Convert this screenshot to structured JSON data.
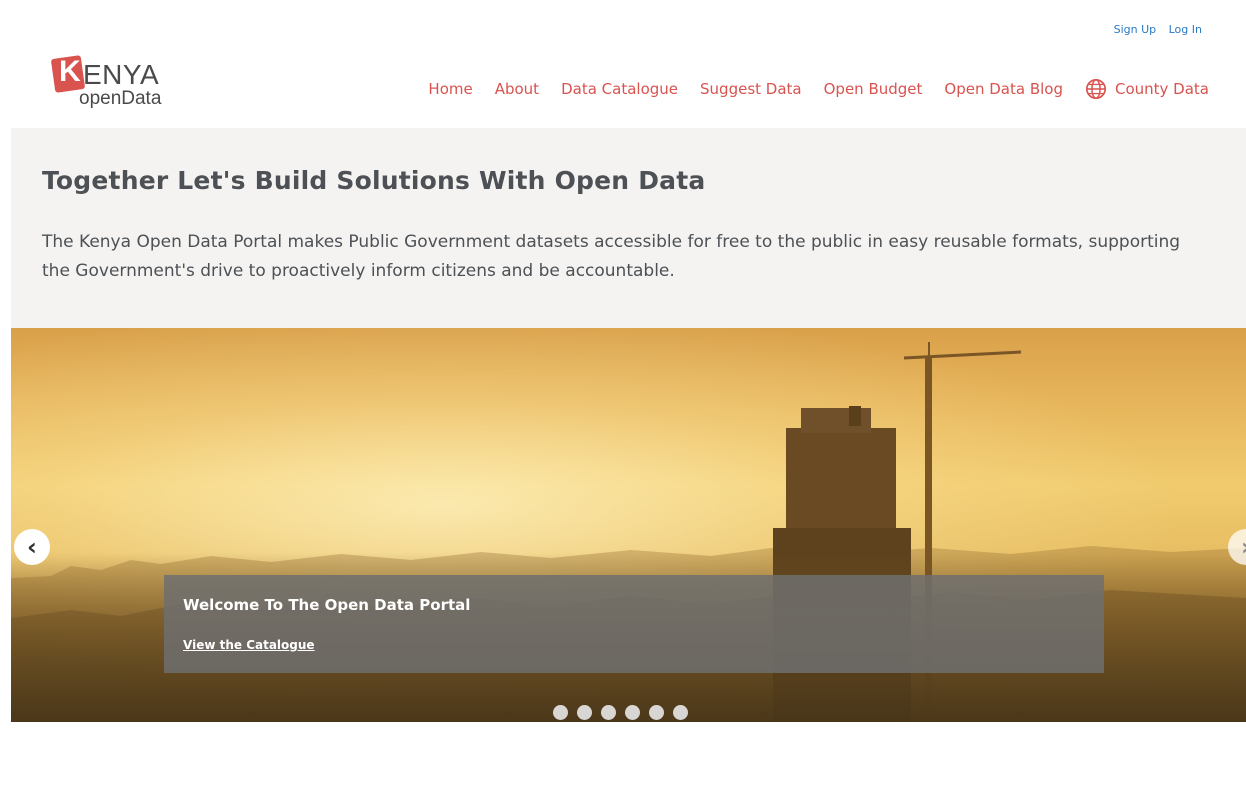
{
  "account": {
    "signup": "Sign Up",
    "login": "Log In"
  },
  "logo": {
    "k": "K",
    "enya": "ENYA",
    "open": "openData"
  },
  "nav": {
    "items": [
      "Home",
      "About",
      "Data Catalogue",
      "Suggest Data",
      "Open Budget",
      "Open Data Blog"
    ],
    "county": "County Data",
    "county_icon": "globe-icon",
    "link_color": "#d9534f"
  },
  "hero": {
    "title": "Together Let's Build Solutions With Open Data",
    "description": "The Kenya Open Data Portal makes Public Government datasets accessible for free to the public in easy reusable formats, supporting the Government's drive to proactively inform citizens and be accountable."
  },
  "carousel": {
    "caption_title": "Welcome To The Open Data Portal",
    "caption_link": "View the Catalogue",
    "slide_count": 6,
    "active_index": 0,
    "prev_icon": "chevron-left-icon",
    "next_icon": "chevron-right-icon"
  }
}
